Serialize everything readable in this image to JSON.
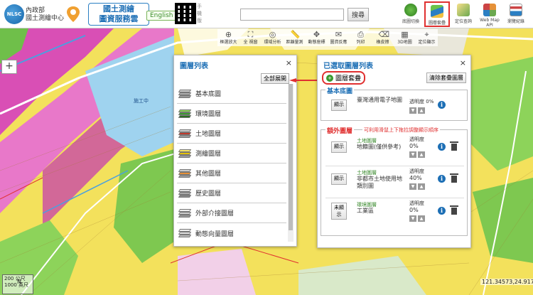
{
  "header": {
    "logo_text": "NLSC",
    "org_line1": "內政部",
    "org_line2": "國土測繪中心",
    "site_title_line1": "國土測繪",
    "site_title_line2": "圖資服務雲",
    "lang_button": "English",
    "mobile_text": "手機版",
    "search_placeholder": "",
    "search_button": "搜尋",
    "nav": [
      {
        "label": "底圖切換",
        "icon": "globe-icon",
        "color": "#3a9a2f"
      },
      {
        "label": "圖層套疊",
        "icon": "layers-icon",
        "color": "#2b7fc3"
      },
      {
        "label": "定位查詢",
        "icon": "location-search-icon",
        "color": "#6aa84f"
      },
      {
        "label": "Web Map API",
        "icon": "api-icon",
        "color": "#e69138"
      },
      {
        "label": "瀏覽紀錄",
        "icon": "history-icon",
        "color": "#cc4444"
      },
      {
        "label": "首頁",
        "icon": "home-icon",
        "color": "#1d6fb5"
      }
    ]
  },
  "map_tools": [
    {
      "label": "框選放大",
      "icon": "zoom-in-icon",
      "glyph": "⊕"
    },
    {
      "label": "全 視窗",
      "icon": "full-extent-icon",
      "glyph": "⛶"
    },
    {
      "label": "環域分析",
      "icon": "buffer-icon",
      "glyph": "◎"
    },
    {
      "label": "距離量測",
      "icon": "measure-icon",
      "glyph": "📏"
    },
    {
      "label": "動態座標",
      "icon": "coordinate-icon",
      "glyph": "✥"
    },
    {
      "label": "圖資反應",
      "icon": "feedback-icon",
      "glyph": "✉"
    },
    {
      "label": "列印",
      "icon": "print-icon",
      "glyph": "⎙"
    },
    {
      "label": "橡皮擦",
      "icon": "eraser-icon",
      "glyph": "⌫"
    },
    {
      "label": "3D地圖",
      "icon": "3d-map-icon",
      "glyph": "▦"
    },
    {
      "label": "定位顯示",
      "icon": "locate-icon",
      "glyph": "⌖"
    }
  ],
  "layer_list": {
    "title": "圖層列表",
    "expand_all": "全部展開",
    "close": "×",
    "items": [
      {
        "label": "基本底圖",
        "icon": "base-map-icon",
        "color": "#999999"
      },
      {
        "label": "環境圖層",
        "icon": "environment-layer-icon",
        "color": "#3a9a2f"
      },
      {
        "label": "土地圖層",
        "icon": "land-layer-icon",
        "color": "#c0392b"
      },
      {
        "label": "測繪圖層",
        "icon": "survey-layer-icon",
        "color": "#e6c200"
      },
      {
        "label": "其他圖層",
        "icon": "other-layer-icon",
        "color": "#e69138"
      },
      {
        "label": "歷史圖層",
        "icon": "history-layer-icon",
        "color": "#888888"
      },
      {
        "label": "外部介接圖層",
        "icon": "external-layer-icon",
        "color": "#999999"
      },
      {
        "label": "動態向量圖層",
        "icon": "vector-layer-icon",
        "color": "#aaaaaa"
      }
    ]
  },
  "selected_layers": {
    "title": "已選取圖層列表",
    "close": "×",
    "overlay_button": "圖層套疊",
    "clear_button": "清除套疊圖層",
    "base_group_title": "基本底圖",
    "base_row": {
      "show_label": "顯示",
      "name": "臺灣通用電子地圖",
      "opacity_label": "透明度",
      "opacity_value": "0%"
    },
    "extra_group_title": "額外圖層",
    "extra_group_note": "可利用滑鼠上下拖拉調整顯示順序",
    "extra_rows": [
      {
        "show_label": "顯示",
        "category": "土地圖層",
        "name": "地籍圖(僅供參考)",
        "opacity_label": "透明度",
        "opacity_value": "0%"
      },
      {
        "show_label": "顯示",
        "category": "土地圖層",
        "name": "非都市土地使用地類別圖",
        "opacity_label": "透明度",
        "opacity_value": "40%"
      },
      {
        "show_label": "未顯示",
        "category": "環境圖層",
        "name": "工業區",
        "opacity_label": "透明度",
        "opacity_value": "0%"
      }
    ]
  },
  "map": {
    "place_label": "施工中",
    "scale_top": "200 公尺",
    "scale_bottom": "1000 英尺",
    "compass": "N",
    "coordinates": "121.34573,24.91727"
  }
}
